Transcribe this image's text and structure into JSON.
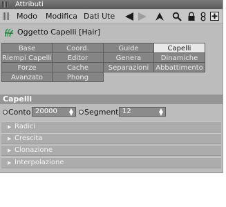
{
  "window": {
    "title": "Attributi"
  },
  "menu": {
    "items": [
      "Modo",
      "Modifica",
      "Dati Ute"
    ]
  },
  "toolbar": {
    "icons": [
      "arrow-left-icon",
      "arrow-right-icon",
      "cursor-up-icon",
      "search-icon",
      "lock-icon",
      "link-icon",
      "add-panel-icon"
    ]
  },
  "object": {
    "label": "Oggetto Capelli [Hair]",
    "icon": "hair-object-icon"
  },
  "tabs": {
    "row1": [
      "Base",
      "Coord.",
      "Guide",
      "Capelli"
    ],
    "row2": [
      "Riempi Capelli",
      "Editor",
      "Genera",
      "Dinamiche"
    ],
    "row3": [
      "Forze",
      "Cache",
      "Separazioni",
      "Abbattimento"
    ],
    "row4": [
      "Avanzato",
      "Phong"
    ],
    "active": "Capelli"
  },
  "section": {
    "title": "Capelli"
  },
  "params": {
    "conto_label": "Conto",
    "conto_value": "20000",
    "segmenti_label": "Segmenti",
    "segmenti_value": "12"
  },
  "groups": [
    "Radici",
    "Crescita",
    "Clonazione",
    "Interpolazione"
  ],
  "colors": {
    "tab_inactive": "#858585",
    "tab_active": "#e8e8e8",
    "panel": "#bcbcbc"
  }
}
